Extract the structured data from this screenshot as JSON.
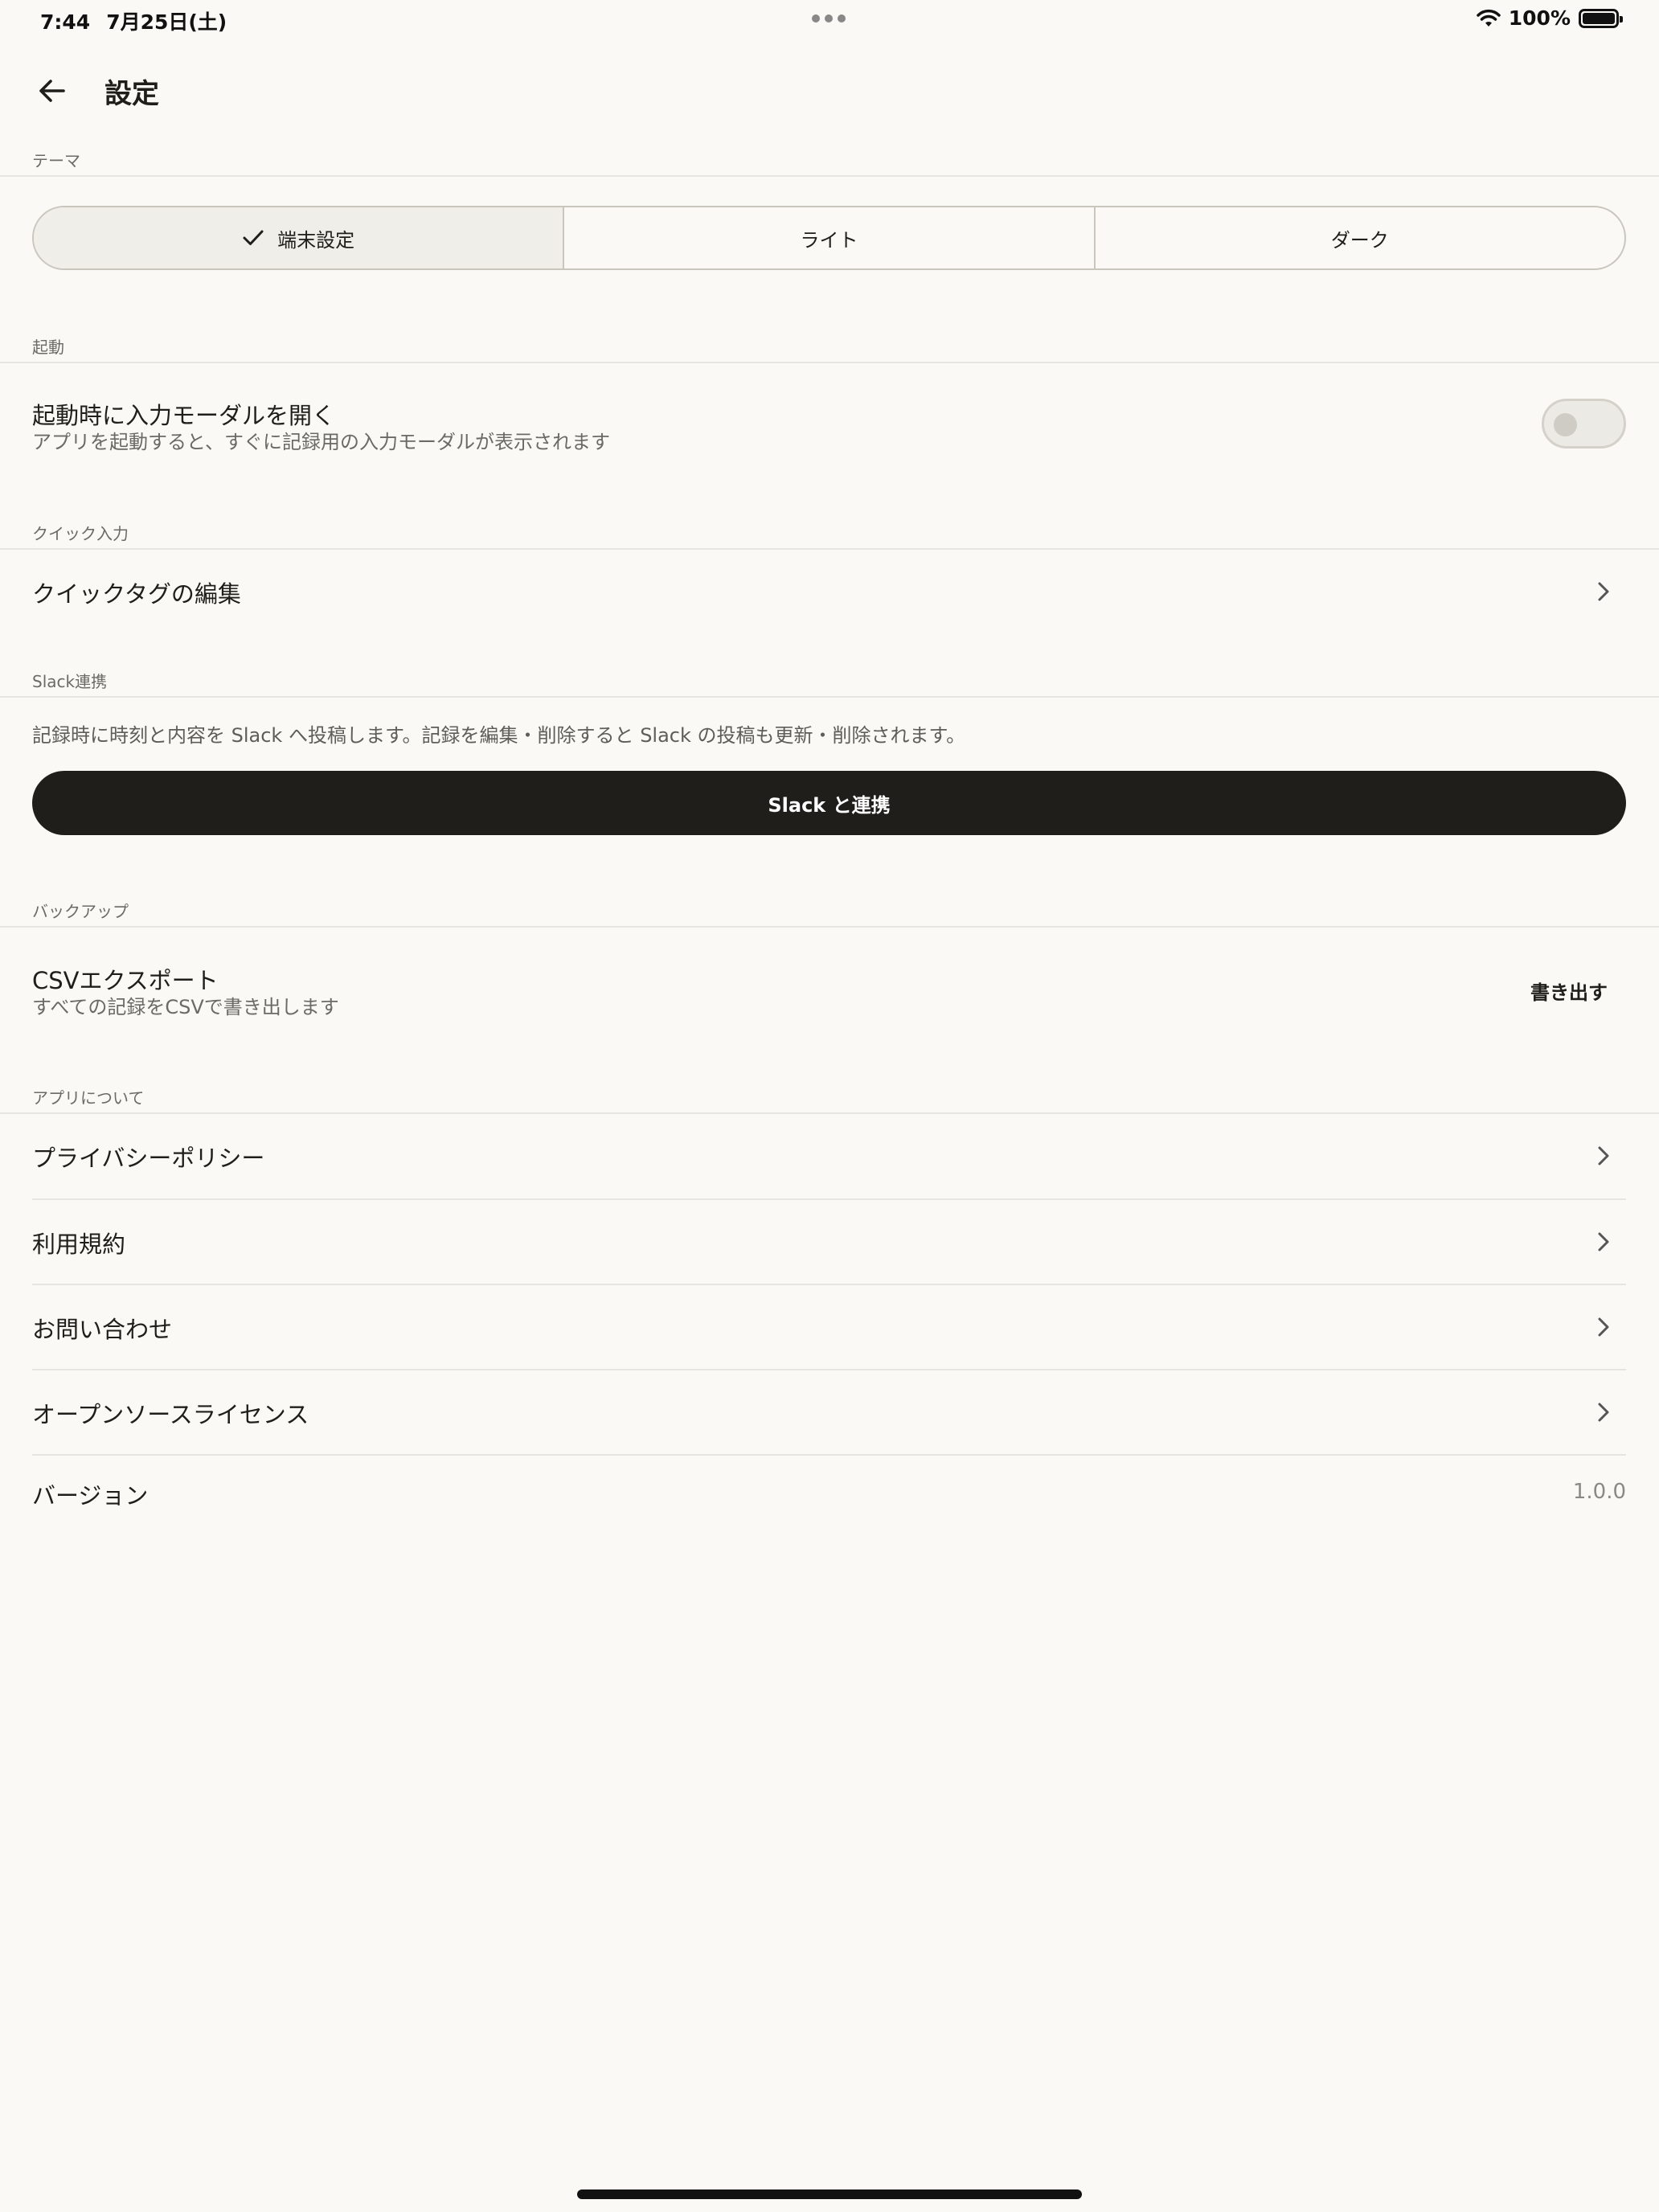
{
  "status_bar": {
    "time": "7:44",
    "date": "7月25日(土)",
    "battery": "100%"
  },
  "header": {
    "title": "設定"
  },
  "theme": {
    "section": "テーマ",
    "options": [
      "端末設定",
      "ライト",
      "ダーク"
    ],
    "selected": "端末設定"
  },
  "startup": {
    "section": "起動",
    "title": "起動時に入力モーダルを開く",
    "subtitle": "アプリを起動すると、すぐに記録用の入力モーダルが表示されます",
    "enabled": false
  },
  "quick_input": {
    "section": "クイック入力",
    "title": "クイックタグの編集"
  },
  "slack": {
    "section": "Slack連携",
    "description": "記録時に時刻と内容を Slack へ投稿します。記録を編集・削除すると Slack の投稿も更新・削除されます。",
    "button": "Slack と連携"
  },
  "backup": {
    "section": "バックアップ",
    "title": "CSVエクスポート",
    "subtitle": "すべての記録をCSVで書き出します",
    "button": "書き出す"
  },
  "about": {
    "section": "アプリについて",
    "items": [
      "プライバシーポリシー",
      "利用規約",
      "お問い合わせ",
      "オープンソースライセンス"
    ],
    "version_label": "バージョン",
    "version_value": "1.0.0"
  },
  "icons": {
    "back": "arrow-left-icon",
    "check": "checkmark-icon",
    "chevron": "chevron-right-icon",
    "wifi": "wifi-icon",
    "battery": "battery-icon"
  },
  "colors": {
    "background": "#faf9f5",
    "primary_button": "#1f1e1b",
    "text": "#1f1e1b",
    "secondary_text": "#6b6a66",
    "divider": "#e7e5df"
  }
}
